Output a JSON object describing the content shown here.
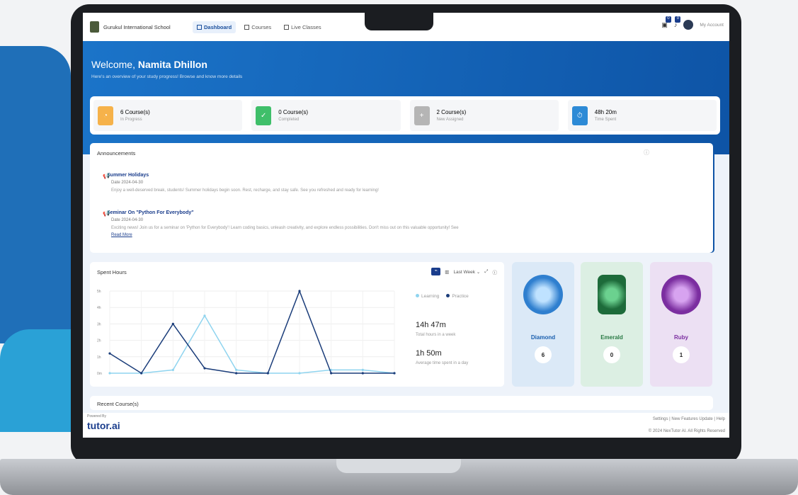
{
  "school": "Gurukul International School",
  "nav": [
    "Dashboard",
    "Courses",
    "Live Classes"
  ],
  "notif_counts": [
    "0",
    "0"
  ],
  "account": "My Account",
  "welcome_prefix": "Welcome,",
  "user": "Namita Dhillon",
  "subtitle": "Here's an overview of your study progress! Browse and know more details",
  "stats": [
    {
      "value": "6 Course(s)",
      "label": "In Progress",
      "color": "#f6b24a"
    },
    {
      "value": "0 Course(s)",
      "label": "Completed",
      "color": "#3fbf6a"
    },
    {
      "value": "2 Course(s)",
      "label": "New Assigned",
      "color": "#9a9a9a"
    },
    {
      "value": "48h 20m",
      "label": "Time Spent",
      "color": "#2d8ad6"
    }
  ],
  "announcements_title": "Announcements",
  "announcements": [
    {
      "title": "Summer Holidays",
      "date": "Date 2024-04-30",
      "text": "Enjoy a well-deserved break, students! Summer holidays begin soon. Rest, recharge, and stay safe. See you refreshed and ready for learning!"
    },
    {
      "title": "Seminar On \"Python For Everybody\"",
      "date": "Date 2024-04-30",
      "text": "Exciting news! Join us for a seminar on 'Python for Everybody'! Learn coding basics, unleash creativity, and explore endless possibilities. Don't miss out on this valuable opportunity! See",
      "more": "Read More"
    }
  ],
  "spent_title": "Spent Hours",
  "range": "Last Week",
  "legend": [
    "Learning",
    "Practice"
  ],
  "total": "14h 47m",
  "total_label": "Total hours in a week",
  "avg": "1h 50m",
  "avg_label": "Average time spent in a day",
  "chart_data": {
    "type": "line",
    "y_ticks": [
      "5h",
      "4h",
      "3h",
      "2h",
      "1h",
      "0m"
    ],
    "ylim": [
      0,
      5
    ],
    "series": [
      {
        "name": "Learning",
        "color": "#8fd4ef",
        "values": [
          0,
          0,
          0.2,
          3.5,
          0.2,
          0,
          0,
          0.2,
          0.2,
          0
        ]
      },
      {
        "name": "Practice",
        "color": "#1b3d7a",
        "values": [
          1.2,
          0,
          3.0,
          0.3,
          0,
          0,
          5.0,
          0,
          0,
          0
        ]
      }
    ]
  },
  "gems": [
    {
      "name": "Diamond",
      "count": "6",
      "bg": "#dbe9f7",
      "color": "#1a5fae",
      "gem": "#2f7fcf"
    },
    {
      "name": "Emerald",
      "count": "0",
      "bg": "#dcefe3",
      "color": "#2a7a45",
      "gem": "#1d6b3a"
    },
    {
      "name": "Ruby",
      "count": "1",
      "bg": "#ece0f3",
      "color": "#7b2ea0",
      "gem": "#7b2ea0"
    }
  ],
  "recent_title": "Recent Course(s)",
  "powered": "Powered By",
  "footer_brand": "tutor.ai",
  "footer_links": "Settings | New Features Update | Help",
  "copyright": "© 2024 NexTutor AI. All Rights Reserved"
}
